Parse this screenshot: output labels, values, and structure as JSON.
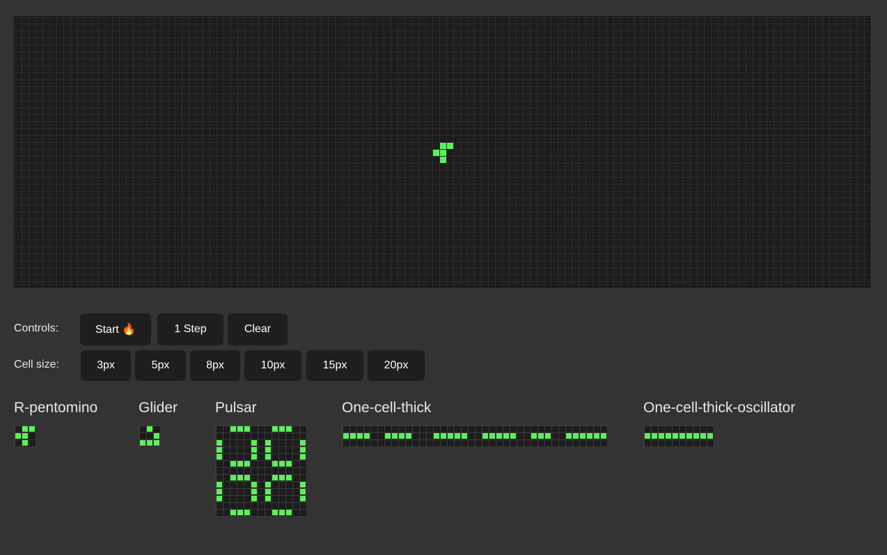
{
  "colors": {
    "background": "#333333",
    "board": "#1c1c1c",
    "live_cell": "#5cf05c",
    "button": "#1e1e1e"
  },
  "board": {
    "cell_size": "10px",
    "live_cells": [
      [
        61,
        18
      ],
      [
        62,
        18
      ],
      [
        60,
        19
      ],
      [
        61,
        19
      ],
      [
        61,
        20
      ]
    ]
  },
  "controls": {
    "label": "Controls:",
    "start_label": "Start 🔥",
    "step_label": "1 Step",
    "clear_label": "Clear"
  },
  "cell_size": {
    "label": "Cell size:",
    "options": [
      "3px",
      "5px",
      "8px",
      "10px",
      "15px",
      "20px"
    ]
  },
  "presets": [
    {
      "name": "R-pentomino",
      "cols": 3,
      "rows": 3,
      "cells": [
        [
          1,
          0
        ],
        [
          2,
          0
        ],
        [
          0,
          1
        ],
        [
          1,
          1
        ],
        [
          1,
          2
        ]
      ]
    },
    {
      "name": "Glider",
      "cols": 3,
      "rows": 3,
      "cells": [
        [
          1,
          0
        ],
        [
          2,
          1
        ],
        [
          0,
          2
        ],
        [
          1,
          2
        ],
        [
          2,
          2
        ]
      ]
    },
    {
      "name": "Pulsar",
      "cols": 13,
      "rows": 13,
      "cells": [
        [
          2,
          0
        ],
        [
          3,
          0
        ],
        [
          4,
          0
        ],
        [
          8,
          0
        ],
        [
          9,
          0
        ],
        [
          10,
          0
        ],
        [
          0,
          2
        ],
        [
          5,
          2
        ],
        [
          7,
          2
        ],
        [
          12,
          2
        ],
        [
          0,
          3
        ],
        [
          5,
          3
        ],
        [
          7,
          3
        ],
        [
          12,
          3
        ],
        [
          0,
          4
        ],
        [
          5,
          4
        ],
        [
          7,
          4
        ],
        [
          12,
          4
        ],
        [
          2,
          5
        ],
        [
          3,
          5
        ],
        [
          4,
          5
        ],
        [
          8,
          5
        ],
        [
          9,
          5
        ],
        [
          10,
          5
        ],
        [
          2,
          7
        ],
        [
          3,
          7
        ],
        [
          4,
          7
        ],
        [
          8,
          7
        ],
        [
          9,
          7
        ],
        [
          10,
          7
        ],
        [
          0,
          8
        ],
        [
          5,
          8
        ],
        [
          7,
          8
        ],
        [
          12,
          8
        ],
        [
          0,
          9
        ],
        [
          5,
          9
        ],
        [
          7,
          9
        ],
        [
          12,
          9
        ],
        [
          0,
          10
        ],
        [
          5,
          10
        ],
        [
          7,
          10
        ],
        [
          12,
          10
        ],
        [
          2,
          12
        ],
        [
          3,
          12
        ],
        [
          4,
          12
        ],
        [
          8,
          12
        ],
        [
          9,
          12
        ],
        [
          10,
          12
        ]
      ]
    },
    {
      "name": "One-cell-thick",
      "cols": 38,
      "rows": 3,
      "cells": [
        [
          0,
          1
        ],
        [
          1,
          1
        ],
        [
          2,
          1
        ],
        [
          3,
          1
        ],
        [
          6,
          1
        ],
        [
          7,
          1
        ],
        [
          8,
          1
        ],
        [
          9,
          1
        ],
        [
          13,
          1
        ],
        [
          14,
          1
        ],
        [
          15,
          1
        ],
        [
          16,
          1
        ],
        [
          17,
          1
        ],
        [
          20,
          1
        ],
        [
          21,
          1
        ],
        [
          22,
          1
        ],
        [
          23,
          1
        ],
        [
          24,
          1
        ],
        [
          27,
          1
        ],
        [
          28,
          1
        ],
        [
          29,
          1
        ],
        [
          32,
          1
        ],
        [
          33,
          1
        ],
        [
          34,
          1
        ],
        [
          35,
          1
        ],
        [
          36,
          1
        ],
        [
          37,
          1
        ]
      ]
    },
    {
      "name": "One-cell-thick-oscillator",
      "cols": 10,
      "rows": 3,
      "cells": [
        [
          0,
          1
        ],
        [
          1,
          1
        ],
        [
          2,
          1
        ],
        [
          3,
          1
        ],
        [
          4,
          1
        ],
        [
          5,
          1
        ],
        [
          6,
          1
        ],
        [
          7,
          1
        ],
        [
          8,
          1
        ],
        [
          9,
          1
        ]
      ]
    }
  ]
}
